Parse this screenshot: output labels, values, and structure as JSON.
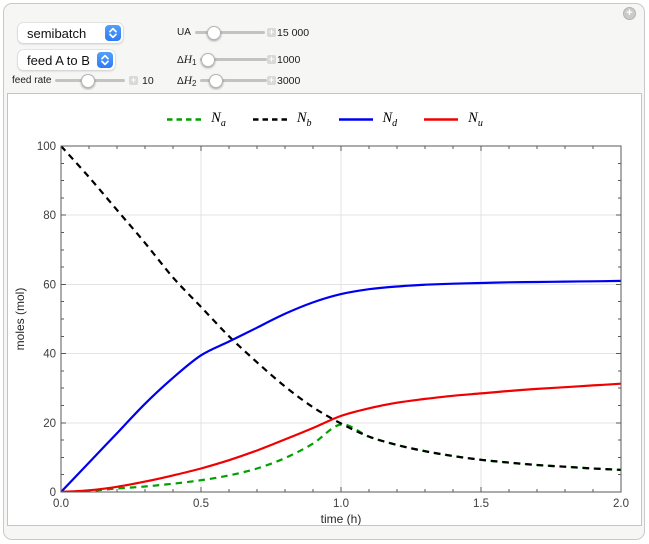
{
  "expand_button": {
    "glyph": "+"
  },
  "stepper": {
    "glyph": "+"
  },
  "controls": {
    "mode_dropdown": {
      "value": "semibatch"
    },
    "feed_dropdown": {
      "value": "feed A to B"
    },
    "feed_rate": {
      "label": "feed rate",
      "value": "10"
    },
    "ua": {
      "label": "UA",
      "value": "15 000"
    },
    "dh1": {
      "label_delta": "Δ",
      "label_var": "H",
      "label_sub": "1",
      "value": "1000"
    },
    "dh2": {
      "label_delta": "Δ",
      "label_var": "H",
      "label_sub": "2",
      "value": "3000"
    }
  },
  "chart_data": {
    "type": "line",
    "title": "",
    "xlabel": "time (h)",
    "ylabel": "moles (mol)",
    "xlim": [
      0,
      2
    ],
    "ylim": [
      0,
      100
    ],
    "grid": true,
    "legend_position": "top",
    "xticks": {
      "major": [
        0,
        0.5,
        1.0,
        1.5,
        2.0
      ],
      "labels": [
        "0.0",
        "0.5",
        "1.0",
        "1.5",
        "2.0"
      ],
      "minor_step": 0.1
    },
    "yticks": {
      "major": [
        0,
        20,
        40,
        60,
        80,
        100
      ],
      "labels": [
        "0",
        "20",
        "40",
        "60",
        "80",
        "100"
      ],
      "minor_step": 5
    },
    "x": [
      0,
      0.1,
      0.2,
      0.3,
      0.4,
      0.5,
      0.6,
      0.7,
      0.8,
      0.9,
      1.0,
      1.1,
      1.2,
      1.3,
      1.4,
      1.5,
      1.6,
      1.7,
      1.8,
      1.9,
      2.0
    ],
    "series": [
      {
        "name": "Na",
        "label_main": "N",
        "label_sub": "a",
        "color": "#00A000",
        "dashed": true,
        "values": [
          0,
          0.3,
          1.0,
          1.6,
          2.4,
          3.4,
          4.8,
          6.8,
          9.8,
          14.0,
          19.5,
          16.0,
          13.6,
          11.8,
          10.4,
          9.3,
          8.5,
          7.8,
          7.3,
          6.8,
          6.4
        ]
      },
      {
        "name": "Nb",
        "label_main": "N",
        "label_sub": "b",
        "color": "#000000",
        "dashed": true,
        "values": [
          100,
          91,
          81.5,
          72,
          62,
          53.5,
          45,
          37.5,
          30.5,
          24.5,
          19.8,
          16.0,
          13.6,
          11.8,
          10.4,
          9.3,
          8.5,
          7.8,
          7.3,
          6.8,
          6.4
        ]
      },
      {
        "name": "Nd",
        "label_main": "N",
        "label_sub": "d",
        "color": "#0000F0",
        "dashed": false,
        "values": [
          0,
          8.5,
          17,
          25.5,
          33,
          39.5,
          43.5,
          47.5,
          51.5,
          54.8,
          57.2,
          58.6,
          59.4,
          59.9,
          60.2,
          60.4,
          60.6,
          60.7,
          60.8,
          60.9,
          61
        ]
      },
      {
        "name": "Nu",
        "label_main": "N",
        "label_sub": "u",
        "color": "#F00000",
        "dashed": false,
        "values": [
          0,
          0.5,
          1.5,
          3.0,
          4.8,
          6.8,
          9.2,
          12.0,
          15.2,
          18.5,
          22.0,
          24.2,
          25.8,
          26.9,
          27.8,
          28.5,
          29.2,
          29.8,
          30.3,
          30.8,
          31.3
        ]
      }
    ]
  }
}
